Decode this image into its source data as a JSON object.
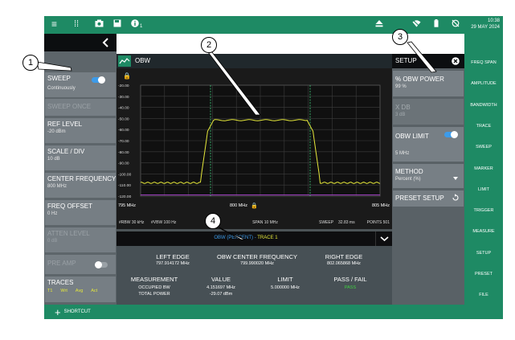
{
  "status_bar": {
    "notification_count": "1",
    "time": "10:38",
    "date": "29 MAY 2024"
  },
  "left_panel": {
    "sweep": {
      "label": "SWEEP",
      "value": "Continuously",
      "toggle_on": true
    },
    "sweep_once": {
      "label": "SWEEP ONCE"
    },
    "ref_level": {
      "label": "REF LEVEL",
      "value": "-20 dBm"
    },
    "scale_div": {
      "label": "SCALE / DIV",
      "value": "10 dB"
    },
    "center_frequency": {
      "label": "CENTER FREQUENCY",
      "value": "800 MHz"
    },
    "freq_offset": {
      "label": "FREQ OFFSET",
      "value": "0 Hz"
    },
    "atten_level": {
      "label": "ATTEN LEVEL",
      "value": "0 dB"
    },
    "pre_amp": {
      "label": "PRE AMP",
      "toggle_on": false
    },
    "traces": {
      "label": "TRACES",
      "items": [
        "T1",
        "Wrt",
        "Avg",
        "Act"
      ]
    }
  },
  "measurement": {
    "title": "OBW",
    "trace_selector": "OBW (PERCENT) - TRACE 1",
    "trace_selector_highlight": "TRACE 1",
    "y_ticks": [
      "-20.00",
      "-30.00",
      "-40.00",
      "-50.00",
      "-60.00",
      "-70.00",
      "-80.00",
      "-90.00",
      "-100.00",
      "-110.00",
      "-120.00"
    ],
    "x_start": "795 MHz",
    "x_center": "800 MHz",
    "x_stop": "805 MHz",
    "rbw": "#RBW 30 kHz",
    "vbw": "#VBW 100 Hz",
    "span": "SPAN 10 MHz",
    "sweep_label": "SWEEP",
    "sweep_time": "32.83 ms",
    "points": "POINTS 501"
  },
  "results": {
    "left_edge_label": "LEFT EDGE",
    "left_edge_value": "797.914172 MHz",
    "center_label": "OBW CENTER FREQUENCY",
    "center_value": "799.990020 MHz",
    "right_edge_label": "RIGHT EDGE",
    "right_edge_value": "802.065868 MHz",
    "headers": [
      "MEASUREMENT",
      "VALUE",
      "LIMIT",
      "PASS / FAIL"
    ],
    "row1": [
      "OCCUPIED BW",
      "4.151697 MHz",
      "5.000000 MHz",
      "PASS"
    ],
    "row2": [
      "TOTAL POWER",
      "-29.07 dBm",
      "",
      ""
    ]
  },
  "right_panel": {
    "header": "SETUP",
    "obw_power": {
      "label": "% OBW POWER",
      "value": "99 %"
    },
    "x_db": {
      "label": "X DB",
      "value": "3 dB"
    },
    "obw_limit": {
      "label": "OBW LIMIT",
      "value": "5 MHz",
      "toggle_on": true
    },
    "method": {
      "label": "METHOD",
      "value": "Percent (%)"
    },
    "preset_setup": {
      "label": "PRESET SETUP"
    }
  },
  "menu": [
    "FREQ SPAN",
    "AMPLITUDE",
    "BANDWIDTH",
    "TRACE",
    "SWEEP",
    "MARKER",
    "LIMIT",
    "TRIGGER",
    "MEASURE",
    "SETUP",
    "PRESET",
    "FILE"
  ],
  "bottom": {
    "shortcut": "SHORTCUT"
  },
  "callouts": [
    "1",
    "2",
    "3",
    "4"
  ],
  "colors": {
    "accent_green": "#1e8a64",
    "trace_yellow": "#e5e83a",
    "toggle_blue": "#3d9be9",
    "pass_green": "#40d040",
    "obw_marker_green": "#3ab870"
  }
}
